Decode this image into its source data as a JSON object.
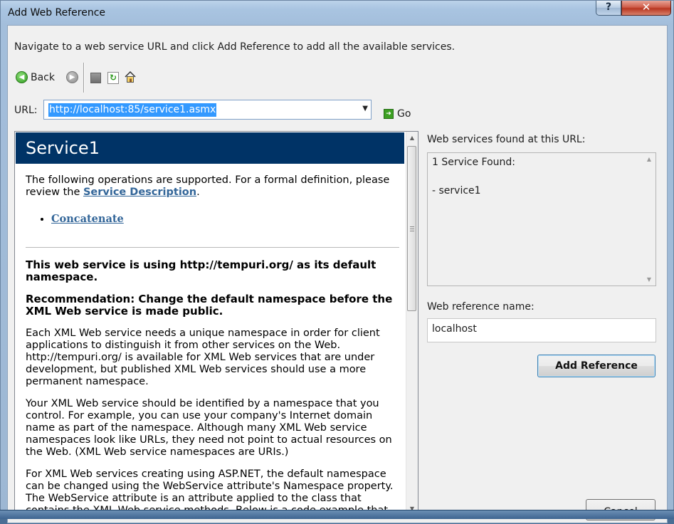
{
  "window": {
    "title": "Add Web Reference",
    "help_label": "?",
    "close_label": "✕"
  },
  "instruction": "Navigate to a web service URL and click Add Reference to add all the available services.",
  "toolbar": {
    "back_label": "Back",
    "back_icon": "back-arrow-icon",
    "forward_icon": "forward-arrow-icon",
    "stop_icon": "stop-icon",
    "refresh_icon": "refresh-icon",
    "home_icon": "home-icon"
  },
  "url": {
    "label": "URL:",
    "value": "http://localhost:85/service1.asmx",
    "go_label": "Go"
  },
  "browser": {
    "header": "Service1",
    "intro_prefix": "The following operations are supported. For a formal definition, please review the ",
    "intro_link": "Service Description",
    "intro_suffix": ".",
    "operations": [
      "Concatenate"
    ],
    "namespace_heading": "This web service is using http://tempuri.org/ as its default namespace.",
    "recommendation_heading": "Recommendation: Change the default namespace before the XML Web service is made public.",
    "para1": "Each XML Web service needs a unique namespace in order for client applications to distinguish it from other services on the Web. http://tempuri.org/ is available for XML Web services that are under development, but published XML Web services should use a more permanent namespace.",
    "para2": "Your XML Web service should be identified by a namespace that you control. For example, you can use your company's Internet domain name as part of the namespace. Although many XML Web service namespaces look like URLs, they need not point to actual resources on the Web. (XML Web service namespaces are URIs.)",
    "para3": "For XML Web services creating using ASP.NET, the default namespace can be changed using the WebService attribute's Namespace property. The WebService attribute is an attribute applied to the class that contains the XML Web service methods. Below is a code example that sets the"
  },
  "services_panel": {
    "label": "Web services found at this URL:",
    "count_text": "1 Service Found:",
    "items": [
      "- service1"
    ]
  },
  "reference_name": {
    "label": "Web reference name:",
    "value": "localhost"
  },
  "buttons": {
    "add_reference": "Add Reference",
    "cancel": "Cancel"
  },
  "colors": {
    "doc_header_bg": "#003366",
    "link": "#336699",
    "selection": "#3399ff"
  }
}
